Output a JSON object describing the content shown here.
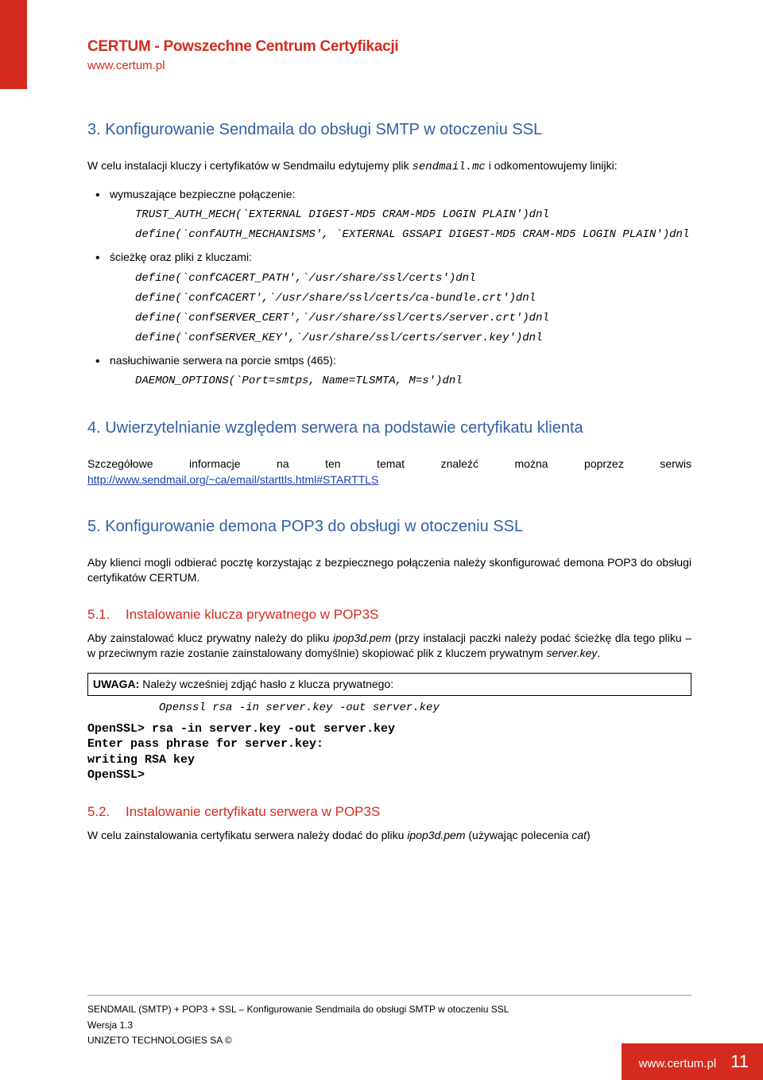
{
  "header": {
    "title": "CERTUM - Powszechne Centrum Certyfikacji",
    "url": "www.certum.pl"
  },
  "section3": {
    "title": "3. Konfigurowanie Sendmaila do obsługi SMTP w otoczeniu SSL",
    "intro_pre": "W celu instalacji kluczy i certyfikatów w Sendmailu edytujemy plik ",
    "intro_file": "sendmail.mc",
    "intro_post": " i odkomentowujemy linijki:",
    "bullet1_label": "wymuszające bezpieczne połączenie:",
    "bullet1_code1": "TRUST_AUTH_MECH(`EXTERNAL DIGEST-MD5 CRAM-MD5 LOGIN PLAIN')dnl",
    "bullet1_code2": "define(`confAUTH_MECHANISMS', `EXTERNAL GSSAPI DIGEST-MD5 CRAM-MD5 LOGIN PLAIN')dnl",
    "bullet2_label": "ścieżkę oraz pliki z kluczami:",
    "bullet2_code1": "define(`confCACERT_PATH',`/usr/share/ssl/certs')dnl",
    "bullet2_code2": "define(`confCACERT',`/usr/share/ssl/certs/ca-bundle.crt')dnl",
    "bullet2_code3": "define(`confSERVER_CERT',`/usr/share/ssl/certs/server.crt')dnl",
    "bullet2_code4": "define(`confSERVER_KEY',`/usr/share/ssl/certs/server.key')dnl",
    "bullet3_label": "nasłuchiwanie serwera na porcie smtps (465):",
    "bullet3_code1": "DAEMON_OPTIONS(`Port=smtps,  Name=TLSMTA, M=s')dnl"
  },
  "section4": {
    "title": "4. Uwierzytelnianie względem serwera na podstawie certyfikatu klienta",
    "text_words": "Szczegółowe informacje na ten temat znaleźć można poprzez serwis",
    "link": "http://www.sendmail.org/~ca/email/starttls.html#STARTTLS"
  },
  "section5": {
    "title": "5. Konfigurowanie demona POP3 do obsługi w otoczeniu SSL",
    "intro": "Aby klienci mogli odbierać pocztę korzystając z bezpiecznego połączenia należy skonfigurować demona POP3 do obsługi certyfikatów CERTUM.",
    "sub51_num": "5.1.",
    "sub51_title": "Instalowanie klucza prywatnego w POP3S",
    "sub51_text_a": "Aby zainstalować klucz prywatny należy do pliku ",
    "sub51_file": "ipop3d.pem",
    "sub51_text_b": " (przy instalacji paczki należy podać ścieżkę dla tego pliku – w przeciwnym razie zostanie zainstalowany domyślnie) skopiować plik z kluczem prywatnym ",
    "sub51_file2": "server.key",
    "sub51_text_c": ".",
    "sub51_notice_bold": "UWAGA:",
    "sub51_notice_text": " Należy wcześniej zdjąć hasło z klucza prywatnego:",
    "sub51_cmd": "Openssl rsa -in server.key -out server.key",
    "sub51_terminal": "OpenSSL> rsa -in server.key -out server.key\nEnter pass phrase for server.key:\nwriting RSA key\nOpenSSL>",
    "sub52_num": "5.2.",
    "sub52_title": "Instalowanie certyfikatu serwera w POP3S",
    "sub52_text_a": "W celu zainstalowania certyfikatu serwera należy dodać do pliku ",
    "sub52_file": "ipop3d.pem",
    "sub52_text_b": " (używając polecenia ",
    "sub52_cmd": "cat",
    "sub52_text_c": ")"
  },
  "footer": {
    "line1": "SENDMAIL (SMTP) + POP3 + SSL  – Konfigurowanie Sendmaila do obsługi SMTP w otoczeniu SSL",
    "line2": "Wersja 1.3",
    "line3": "UNIZETO TECHNOLOGIES SA ©"
  },
  "pagetab": {
    "url": "www.certum.pl",
    "num": "11"
  }
}
